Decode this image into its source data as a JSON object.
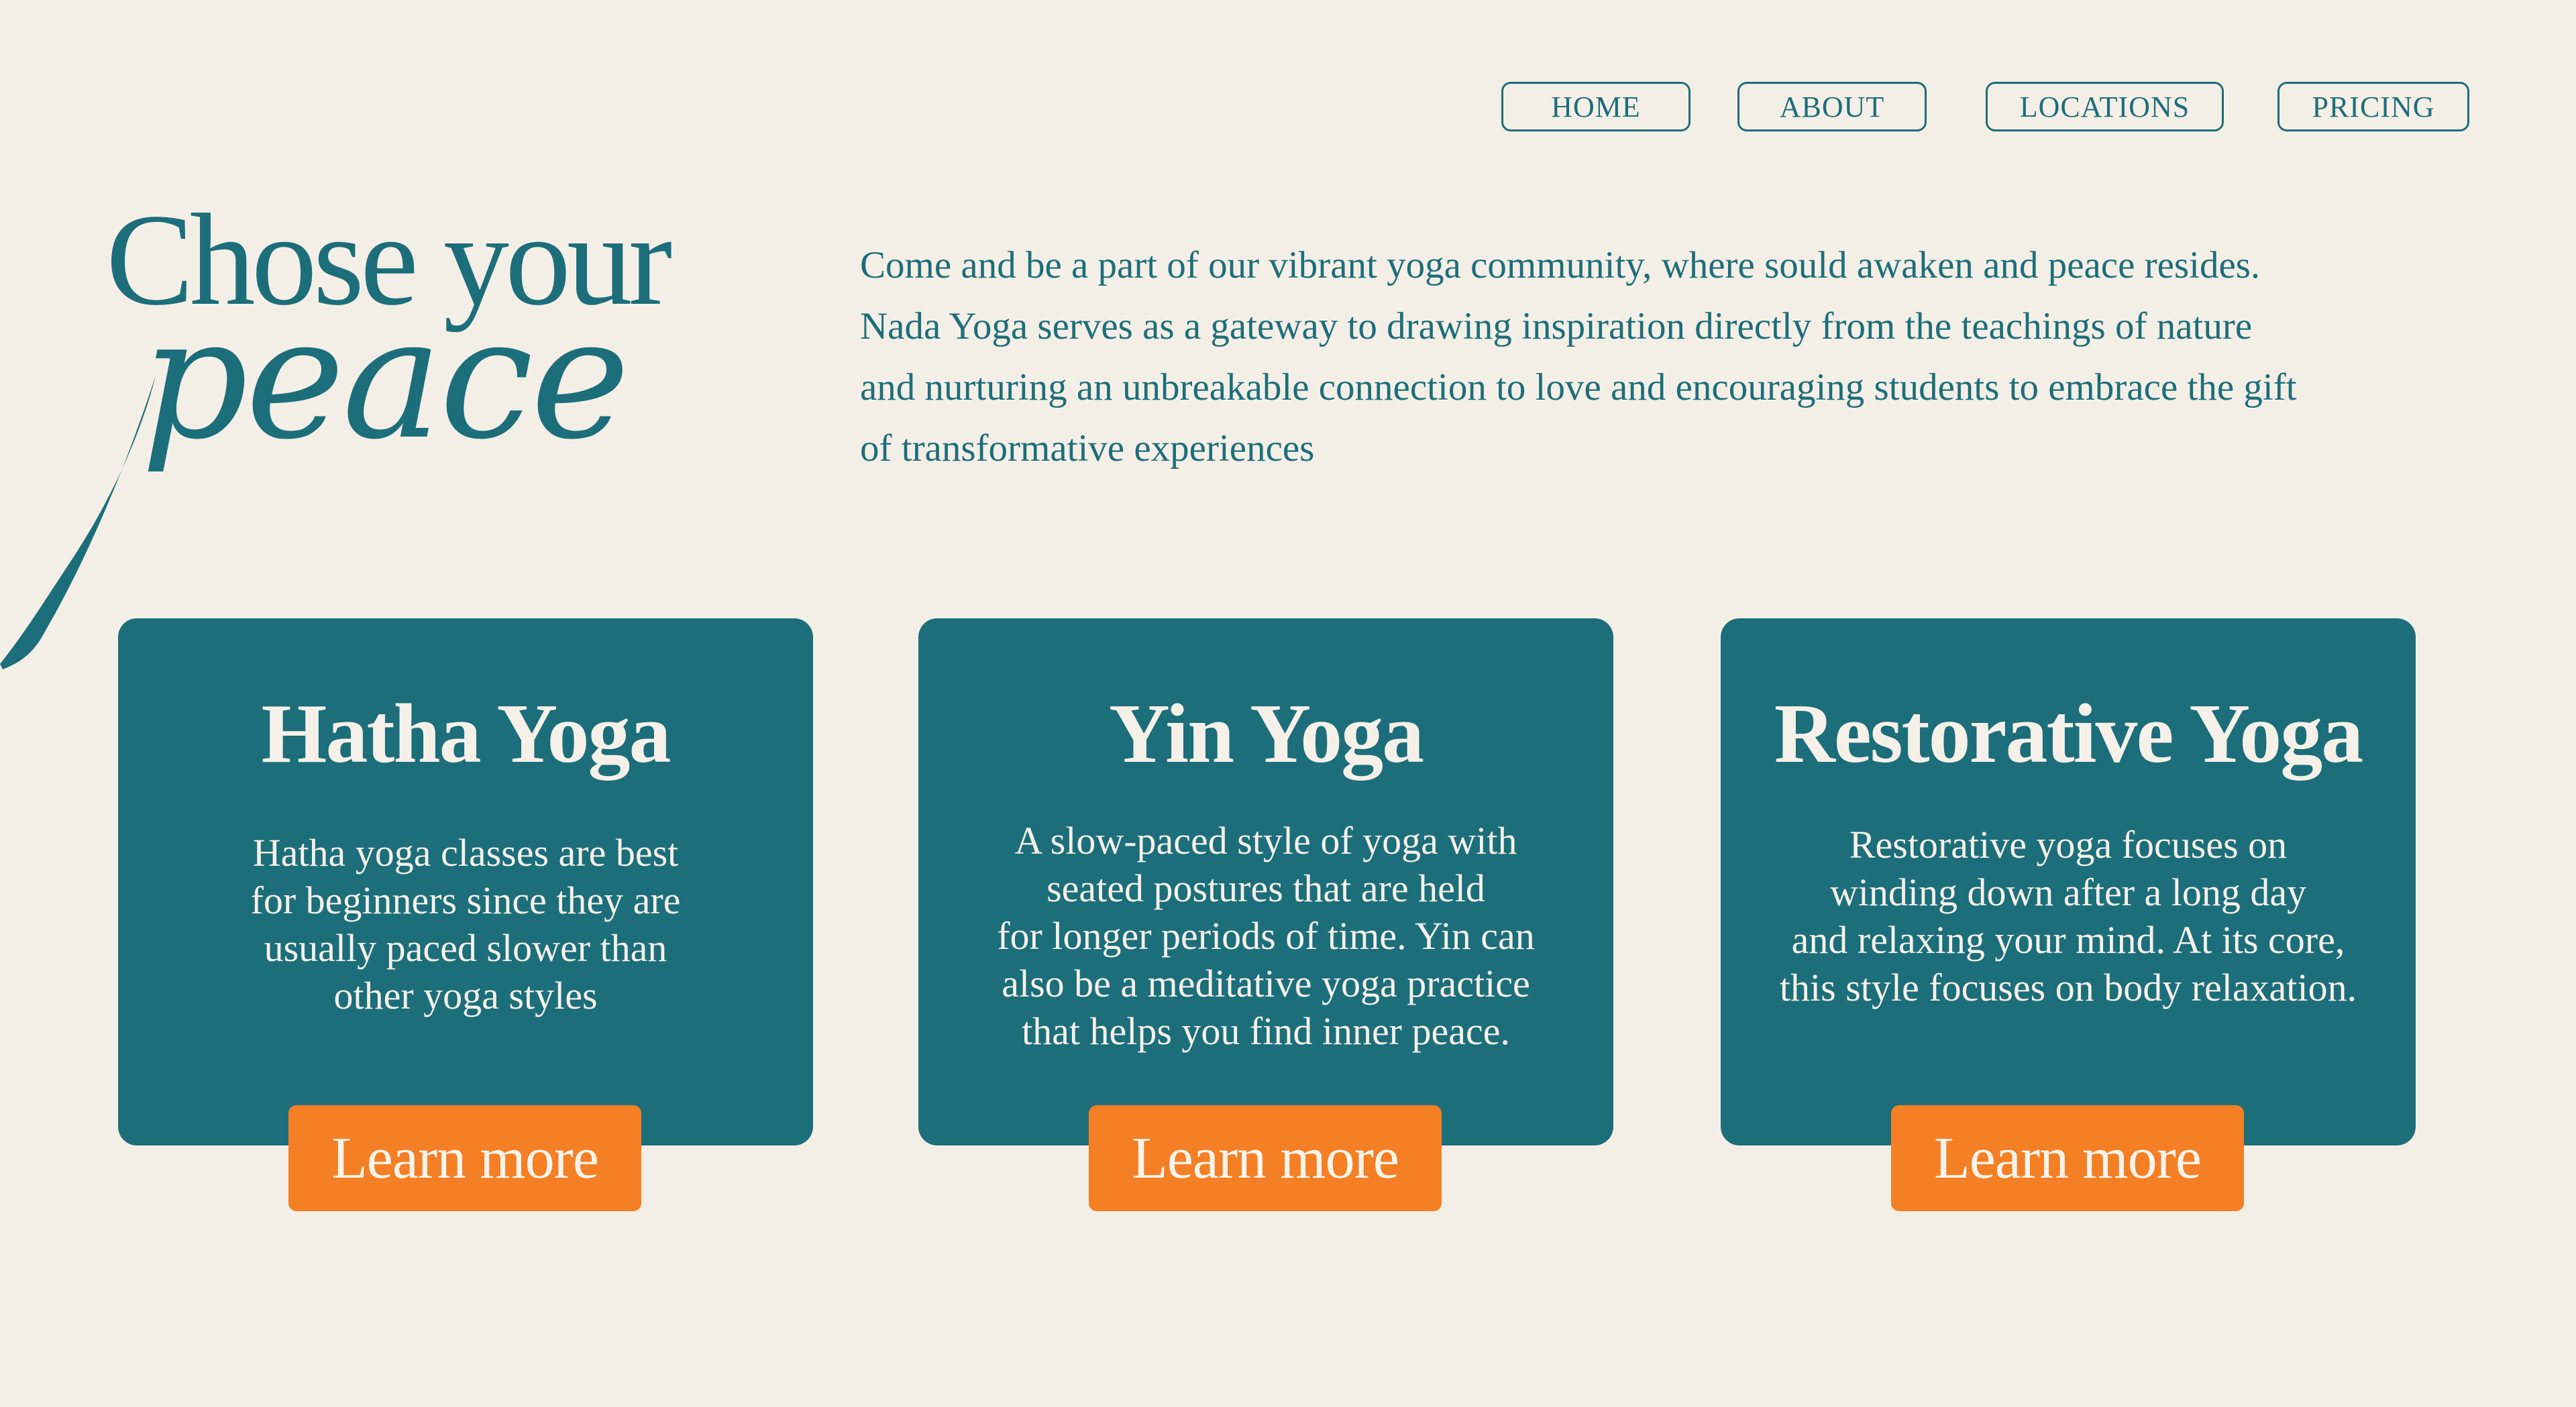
{
  "nav": {
    "home": "HOME",
    "about": "ABOUT",
    "locations": "LOCATIONS",
    "pricing": "PRICING"
  },
  "hero": {
    "title": "Chose your",
    "script_word": "peace",
    "description": "Come and be a part of our vibrant yoga community, where sould awaken and peace resides. Nada Yoga serves as a gateway to drawing inspiration directly from the teachings of nature and nurturing an unbreakable connection to love and encouraging students to embrace the gift of transformative experiences"
  },
  "cards": [
    {
      "title": "Hatha Yoga",
      "lines": [
        "Hatha yoga classes are best",
        "for beginners since they are",
        "usually paced slower than",
        "other yoga styles"
      ],
      "button": "Learn more"
    },
    {
      "title": "Yin Yoga",
      "lines": [
        "A slow-paced style of yoga with",
        "seated postures that are held",
        "for longer periods of time. Yin can",
        "also be a meditative yoga practice",
        "that helps you find inner peace."
      ],
      "button": "Learn more"
    },
    {
      "title": "Restorative Yoga",
      "lines": [
        "Restorative yoga focuses on",
        "winding down after a long day",
        "and relaxing your mind. At its core,",
        "this style focuses on body relaxation."
      ],
      "button": "Learn more"
    }
  ],
  "colors": {
    "background": "#f4efe6",
    "primary": "#1c6e7b",
    "accent": "#f47f25",
    "card_text": "#f6f1e8"
  }
}
